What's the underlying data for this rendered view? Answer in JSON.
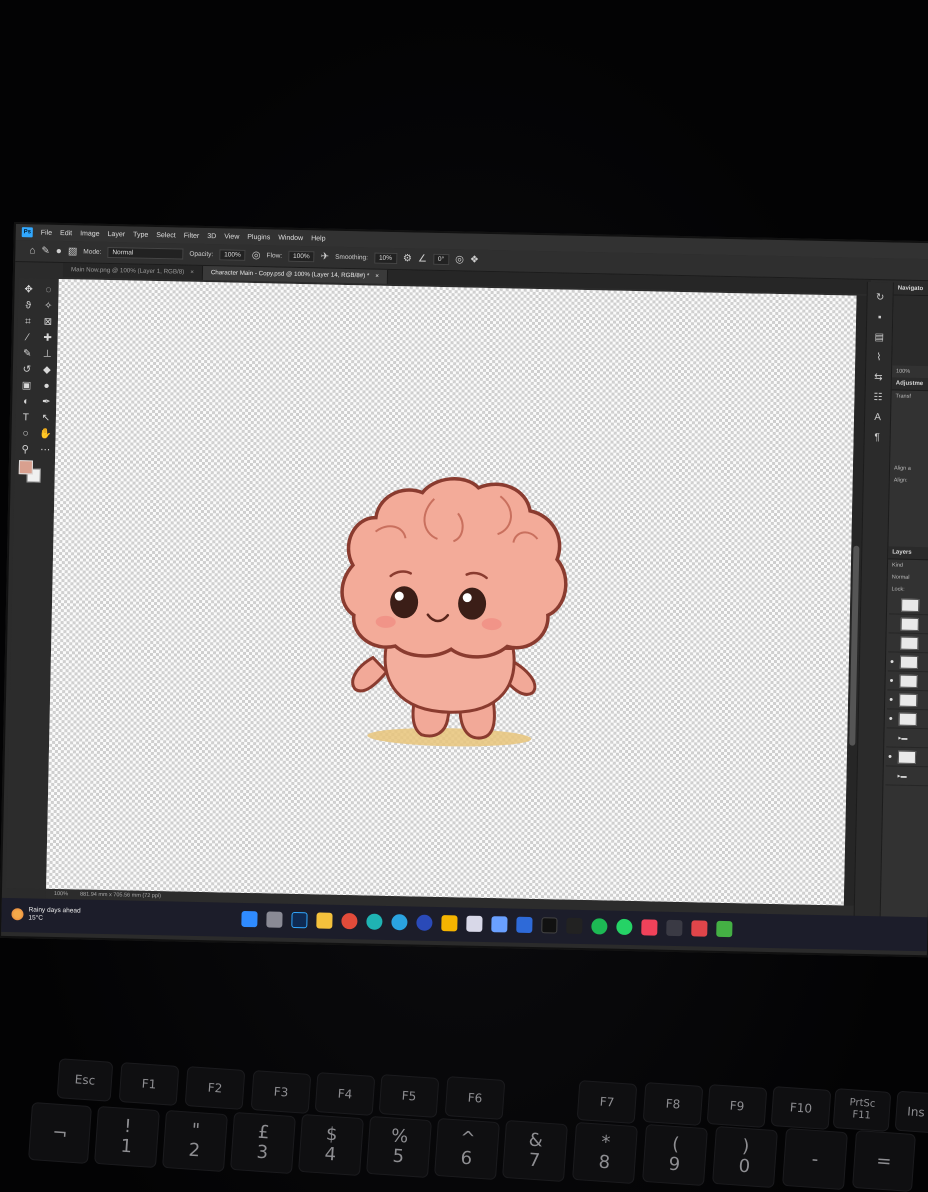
{
  "menu": [
    "File",
    "Edit",
    "Image",
    "Layer",
    "Type",
    "Select",
    "Filter",
    "3D",
    "View",
    "Plugins",
    "Window",
    "Help"
  ],
  "options": {
    "mode_label": "Mode:",
    "mode_value": "Normal",
    "opacity_label": "Opacity:",
    "opacity_value": "100%",
    "flow_label": "Flow:",
    "flow_value": "100%",
    "smoothing_label": "Smoothing:",
    "smoothing_value": "10%",
    "angle_value": "0°"
  },
  "tabs": [
    {
      "label": "Main Now.png @ 100% (Layer 1, RGB/8)",
      "close": "×"
    },
    {
      "label": "Character Main - Copy.psd @ 100% (Layer 14, RGB/8#) *",
      "close": "×"
    }
  ],
  "status": {
    "zoom": "100%",
    "dimensions": "881.94 mm x 705.56 mm (72 ppi)"
  },
  "panels": {
    "navigator": "Navigato",
    "zoom": "100%",
    "adjustments": "Adjustme",
    "transform": "Transf",
    "align": "Align a",
    "align_sub": "Align:",
    "layers_tab": "Layers",
    "kind": "Kind",
    "blend": "Normal",
    "lock": "Lock:"
  },
  "weather": {
    "title": "Rainy days ahead",
    "temp": "15°C"
  },
  "keys": {
    "esc": "Esc",
    "f1": "F1",
    "f2": "F2",
    "f3": "F3",
    "f4": "F4",
    "f5": "F5",
    "f6": "F6",
    "f7": "F7",
    "f8": "F8",
    "f9": "F9",
    "f10": "F10",
    "f11": "F11",
    "prtsc": "PrtSc",
    "ins": "Ins",
    "n1": "1",
    "n2": "2",
    "n3": "3",
    "n4": "4",
    "n5": "5",
    "n6": "6",
    "n7": "7",
    "n8": "8",
    "n9": "9",
    "n0": "0",
    "minus": "-",
    "equals": "=",
    "s1": "!",
    "s2": "\"",
    "s3": "£",
    "s4": "$",
    "s5": "%",
    "s6": "^",
    "s7": "&",
    "s8": "*",
    "s9": "(",
    "s0": ")"
  },
  "colors": {
    "accent": "#31a8ff",
    "foreground_swatch": "#d9a08f",
    "taskbar": "#1c1d2a"
  }
}
